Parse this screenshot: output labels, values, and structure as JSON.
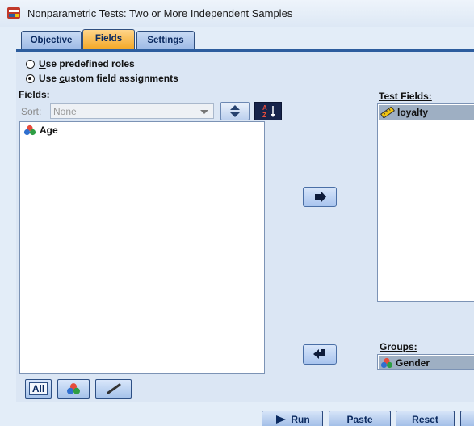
{
  "window": {
    "title": "Nonparametric Tests: Two or More Independent Samples",
    "app_icon": "spss-dialog-icon"
  },
  "tabs": [
    {
      "label": "Objective",
      "active": false
    },
    {
      "label": "Fields",
      "active": true
    },
    {
      "label": "Settings",
      "active": false
    }
  ],
  "roles": {
    "predefined": "Use predefined roles",
    "custom": "Use custom field assignments",
    "selected": "custom"
  },
  "fields_panel": {
    "label": "Fields:",
    "sort_label": "Sort:",
    "sort_value": "None",
    "items": [
      {
        "label": "Age",
        "icon": "nominal-icon"
      }
    ],
    "all_button": "All"
  },
  "test_fields": {
    "label": "Test Fields:",
    "items": [
      {
        "label": "loyalty",
        "icon": "scale-ruler-icon",
        "selected": true
      }
    ]
  },
  "groups": {
    "label": "Groups:",
    "value": "Gender",
    "icon": "nominal-icon"
  },
  "footer": {
    "run": "Run",
    "paste": "Paste",
    "reset": "Reset"
  },
  "colors": {
    "tab_active": "#f4a92a",
    "panel_bg": "#dbe6f4",
    "accent_blue": "#2d5d9e"
  }
}
